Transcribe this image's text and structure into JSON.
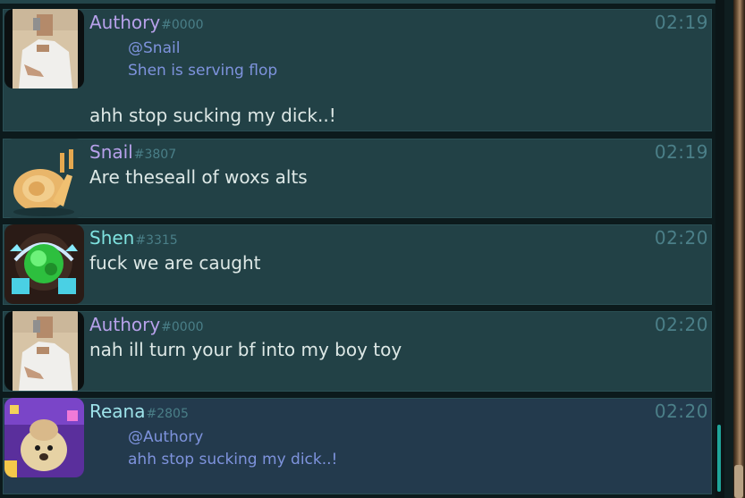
{
  "messages": [
    {
      "author": "Authory",
      "discriminator": "#0000",
      "time": "02:19",
      "reply_mention": "@Snail",
      "reply_text": "Shen is serving flop",
      "text": "ahh stop sucking my dick..!",
      "avatar": "photo-man-avatar"
    },
    {
      "author": "Snail",
      "discriminator": "#3807",
      "time": "02:19",
      "text": "Are theseall of woxs alts",
      "avatar": "snail-plush-avatar"
    },
    {
      "author": "Shen",
      "discriminator": "#3315",
      "time": "02:20",
      "text": "fuck we are caught",
      "avatar": "green-gem-avatar"
    },
    {
      "author": "Authory",
      "discriminator": "#0000",
      "time": "02:20",
      "text": "nah ill turn your bf into my boy toy",
      "avatar": "photo-man-avatar"
    },
    {
      "author": "Reana",
      "discriminator": "#2805",
      "time": "02:20",
      "reply_mention": "@Authory",
      "reply_text": "ahh stop sucking my dick..!",
      "avatar": "dog-purple-avatar"
    }
  ],
  "colors": {
    "authory": "#b7a1ea",
    "snail": "#b7a1ea",
    "shen": "#7fe3e0",
    "reana": "#9ee3ea"
  }
}
